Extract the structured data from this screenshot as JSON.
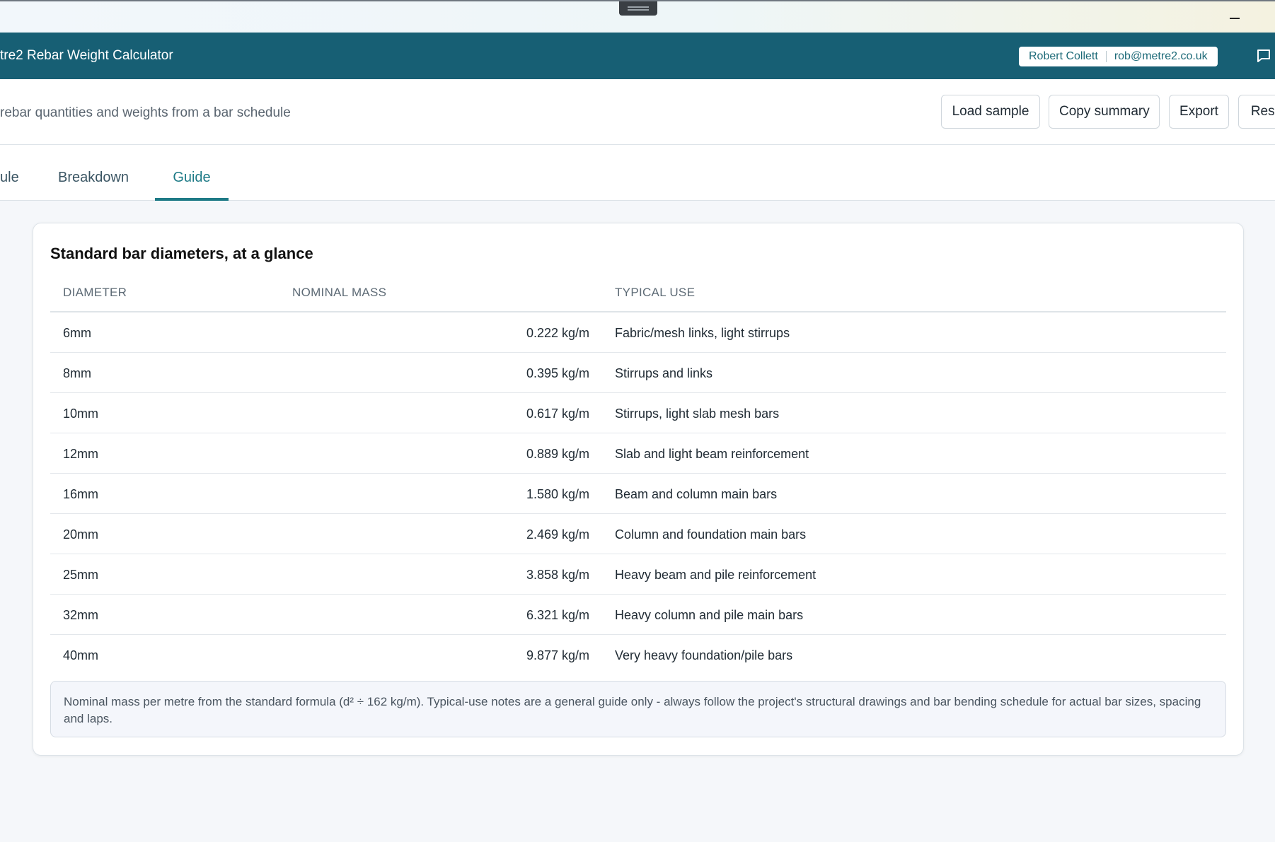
{
  "window": {
    "controls": [
      "minimize-icon"
    ]
  },
  "header": {
    "title": "tre2 Rebar Weight Calculator",
    "user_name": "Robert Collett",
    "user_email": "rob@metre2.co.uk",
    "feedback_icon": "chat-icon"
  },
  "toolbar": {
    "subtitle": "rebar quantities and weights from a bar schedule",
    "load_sample": "Load sample",
    "copy_summary": "Copy summary",
    "export": "Export",
    "reset": "Rese"
  },
  "tabs": [
    {
      "label": "ule",
      "active": false
    },
    {
      "label": "Breakdown",
      "active": false
    },
    {
      "label": "Guide",
      "active": true
    }
  ],
  "guide": {
    "title": "Standard bar diameters, at a glance",
    "columns": [
      "DIAMETER",
      "NOMINAL MASS",
      "TYPICAL USE"
    ],
    "rows": [
      {
        "diameter": "6mm",
        "mass": "0.222 kg/m",
        "use": "Fabric/mesh links, light stirrups"
      },
      {
        "diameter": "8mm",
        "mass": "0.395 kg/m",
        "use": "Stirrups and links"
      },
      {
        "diameter": "10mm",
        "mass": "0.617 kg/m",
        "use": "Stirrups, light slab mesh bars"
      },
      {
        "diameter": "12mm",
        "mass": "0.889 kg/m",
        "use": "Slab and light beam reinforcement"
      },
      {
        "diameter": "16mm",
        "mass": "1.580 kg/m",
        "use": "Beam and column main bars"
      },
      {
        "diameter": "20mm",
        "mass": "2.469 kg/m",
        "use": "Column and foundation main bars"
      },
      {
        "diameter": "25mm",
        "mass": "3.858 kg/m",
        "use": "Heavy beam and pile reinforcement"
      },
      {
        "diameter": "32mm",
        "mass": "6.321 kg/m",
        "use": "Heavy column and pile main bars"
      },
      {
        "diameter": "40mm",
        "mass": "9.877 kg/m",
        "use": "Very heavy foundation/pile bars"
      }
    ],
    "note": "Nominal mass per metre from the standard formula (d² ÷ 162 kg/m). Typical-use notes are a general guide only - always follow the project's structural drawings and bar bending schedule for actual bar sizes, spacing and laps."
  },
  "colors": {
    "header_bg": "#175f74",
    "accent": "#1d7a86"
  }
}
